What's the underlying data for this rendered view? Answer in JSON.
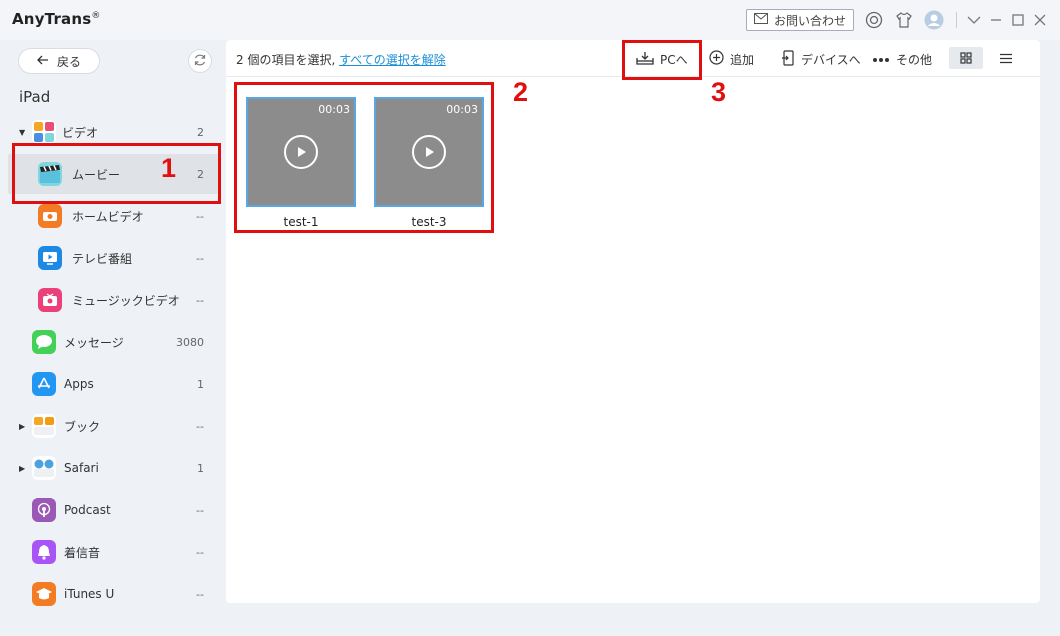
{
  "window": {
    "app_name": "AnyTrans",
    "registered": "®",
    "contact_label": "お問い合わせ"
  },
  "sidebar": {
    "back_label": "戻る",
    "device_name": "iPad",
    "items": [
      {
        "label": "ビデオ",
        "count": "2",
        "expanded": true
      },
      {
        "label": "ムービー",
        "count": "2",
        "selected": true
      },
      {
        "label": "ホームビデオ",
        "count": "--"
      },
      {
        "label": "テレビ番組",
        "count": "--"
      },
      {
        "label": "ミュージックビデオ",
        "count": "--"
      },
      {
        "label": "メッセージ",
        "count": "3080"
      },
      {
        "label": "Apps",
        "count": "1"
      },
      {
        "label": "ブック",
        "count": "--"
      },
      {
        "label": "Safari",
        "count": "1"
      },
      {
        "label": "Podcast",
        "count": "--"
      },
      {
        "label": "着信音",
        "count": "--"
      },
      {
        "label": "iTunes U",
        "count": "--"
      }
    ]
  },
  "toolbar": {
    "selection_text": "2 個の項目を選択, ",
    "deselect_link": "すべての選択を解除",
    "to_pc_label": "PCへ",
    "add_label": "追加",
    "to_device_label": "デバイスへ",
    "more_label": "その他"
  },
  "videos": [
    {
      "title": "test-1",
      "duration": "00:03"
    },
    {
      "title": "test-3",
      "duration": "00:03"
    }
  ],
  "annotations": {
    "step1": "1",
    "step2": "2",
    "step3": "3"
  },
  "colors": {
    "annotation_red": "#e01010",
    "selection_blue": "#58a8e4",
    "link_blue": "#1a8fd8"
  }
}
